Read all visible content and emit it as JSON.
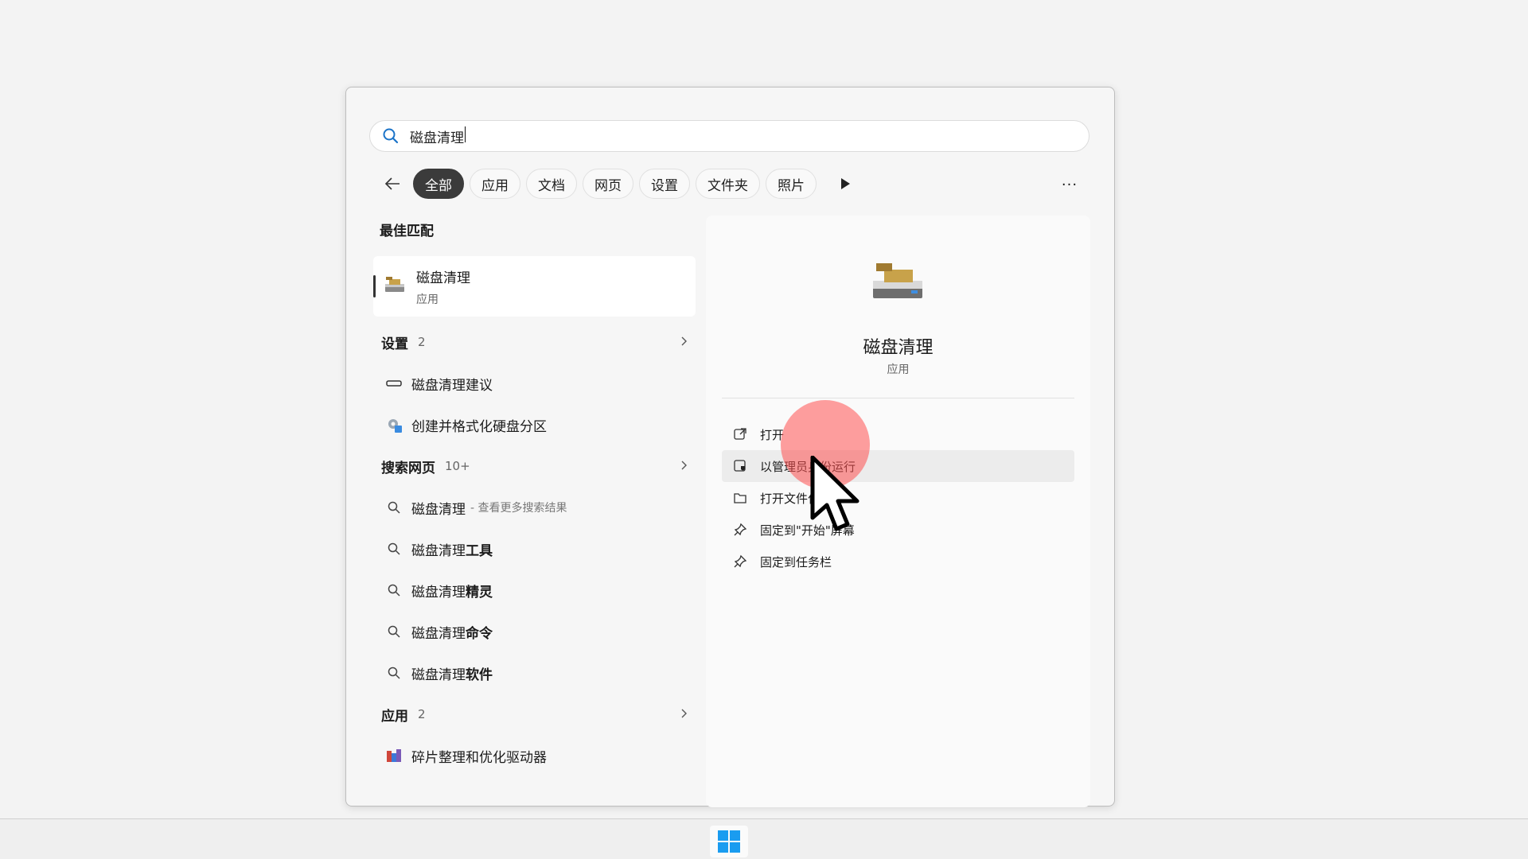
{
  "search": {
    "query": "磁盘清理"
  },
  "filters": {
    "chips": [
      "全部",
      "应用",
      "文档",
      "网页",
      "设置",
      "文件夹",
      "照片"
    ],
    "more": "···"
  },
  "best_match": {
    "heading": "最佳匹配",
    "title": "磁盘清理",
    "subtitle": "应用"
  },
  "settings_group": {
    "title": "设置",
    "count": "2",
    "items": [
      "磁盘清理建议",
      "创建并格式化硬盘分区"
    ]
  },
  "web_group": {
    "title": "搜索网页",
    "count": "10+",
    "first": {
      "text": "磁盘清理",
      "suffix": "- 查看更多搜索结果"
    },
    "suggestions": [
      {
        "prefix": "磁盘清理",
        "bold": "工具"
      },
      {
        "prefix": "磁盘清理",
        "bold": "精灵"
      },
      {
        "prefix": "磁盘清理",
        "bold": "命令"
      },
      {
        "prefix": "磁盘清理",
        "bold": "软件"
      }
    ]
  },
  "apps_group": {
    "title": "应用",
    "count": "2",
    "items": [
      "碎片整理和优化驱动器"
    ]
  },
  "detail": {
    "title": "磁盘清理",
    "subtitle": "应用",
    "actions": [
      "打开",
      "以管理员身份运行",
      "打开文件位置",
      "固定到\"开始\"屏幕",
      "固定到任务栏"
    ]
  },
  "colors": {
    "accent": "#3b3b3b",
    "click_highlight": "#ff5050",
    "win_blue": "#1a9cf0"
  },
  "icons": [
    "search-icon",
    "back-arrow-icon",
    "play-icon",
    "more-icon",
    "disk-cleanup-icon",
    "chevron-right-icon",
    "drive-icon",
    "gear-icon",
    "open-icon",
    "admin-shield-icon",
    "folder-icon",
    "pin-icon",
    "defrag-icon",
    "windows-logo-icon"
  ]
}
